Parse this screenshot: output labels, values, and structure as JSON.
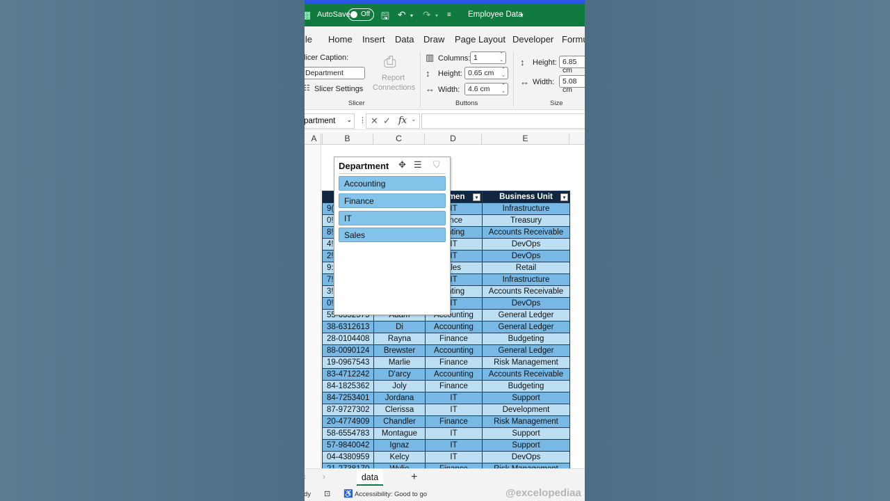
{
  "titlebar": {
    "autosave_label": "AutoSave",
    "autosave_state": "Off",
    "file_name": "Employee Data"
  },
  "menu": [
    "ile",
    "Home",
    "Insert",
    "Data",
    "Draw",
    "Page Layout",
    "Developer",
    "Formu"
  ],
  "ribbon": {
    "slicer_caption_label": "licer Caption:",
    "slicer_caption_value": "Department",
    "slicer_settings_label": "Slicer Settings",
    "report_connections_label1": "Report",
    "report_connections_label2": "Connections",
    "group_slicer": "Slicer",
    "columns_label": "Columns:",
    "columns_value": "1",
    "btn_height_label": "Height:",
    "btn_height_value": "0.65 cm",
    "btn_width_label": "Width:",
    "btn_width_value": "4.6 cm",
    "group_buttons": "Buttons",
    "size_height_label": "Height:",
    "size_height_value": "6.85 cm",
    "size_width_label": "Width:",
    "size_width_value": "5.08 cm",
    "group_size": "Size"
  },
  "formula_bar": {
    "name_box": "partment",
    "fx": "fx"
  },
  "columns": [
    "A",
    "B",
    "C",
    "D",
    "E"
  ],
  "slicer": {
    "title": "Department",
    "items": [
      "Accounting",
      "Finance",
      "IT",
      "Sales"
    ]
  },
  "table": {
    "headers": [
      "",
      "",
      "rtmen",
      "Business Unit"
    ],
    "rows": [
      [
        "9(",
        "",
        "IT",
        "Infrastructure"
      ],
      [
        "0!",
        "",
        "ance",
        "Treasury"
      ],
      [
        "8!",
        "",
        "unting",
        "Accounts Receivable"
      ],
      [
        "4!",
        "",
        "IT",
        "DevOps"
      ],
      [
        "2!",
        "",
        "IT",
        "DevOps"
      ],
      [
        "9:",
        "",
        "ales",
        "Retail"
      ],
      [
        "7!",
        "",
        "IT",
        "Infrastructure"
      ],
      [
        "3!",
        "",
        "unting",
        "Accounts Receivable"
      ],
      [
        "0!",
        "",
        "IT",
        "DevOps"
      ],
      [
        "55-6352575",
        "Adam",
        "Accounting",
        "General Ledger"
      ],
      [
        "38-6312613",
        "Di",
        "Accounting",
        "General Ledger"
      ],
      [
        "28-0104408",
        "Rayna",
        "Finance",
        "Budgeting"
      ],
      [
        "88-0090124",
        "Brewster",
        "Accounting",
        "General Ledger"
      ],
      [
        "19-0967543",
        "Marlie",
        "Finance",
        "Risk Management"
      ],
      [
        "83-4712242",
        "D'arcy",
        "Accounting",
        "Accounts Receivable"
      ],
      [
        "84-1825362",
        "Joly",
        "Finance",
        "Budgeting"
      ],
      [
        "84-7253401",
        "Jordana",
        "IT",
        "Support"
      ],
      [
        "87-9727302",
        "Clerissa",
        "IT",
        "Development"
      ],
      [
        "20-4774909",
        "Chandler",
        "Finance",
        "Risk Management"
      ],
      [
        "58-6554783",
        "Montague",
        "IT",
        "Support"
      ],
      [
        "57-9840042",
        "Ignaz",
        "IT",
        "Support"
      ],
      [
        "04-4380959",
        "Kelcy",
        "IT",
        "DevOps"
      ],
      [
        "21-2738170",
        "Wylie",
        "Finance",
        "Risk Management"
      ]
    ]
  },
  "sheet_tabs": {
    "active": "data",
    "add": "+"
  },
  "statusbar": {
    "ready": "dy",
    "accessibility": "Accessibility: Good to go"
  },
  "watermark": "@excelopediaa"
}
